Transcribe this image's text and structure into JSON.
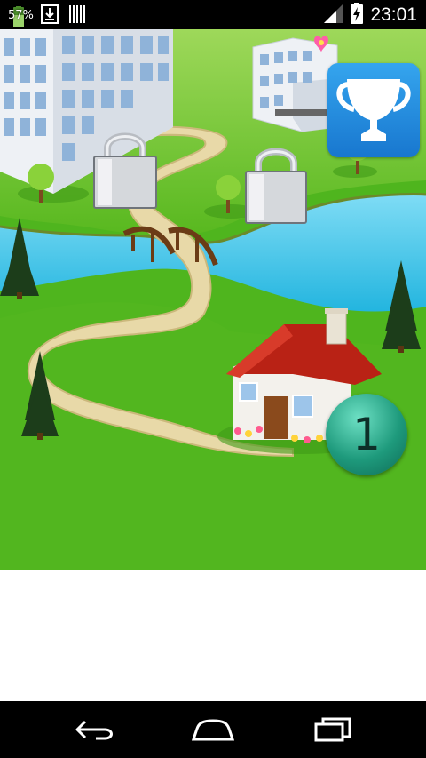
{
  "status_bar": {
    "battery_percent": "57%",
    "time": "23:01",
    "icons": [
      "battery-icon",
      "download-icon",
      "barcode-icon",
      "signal-icon",
      "battery-charging-icon"
    ]
  },
  "game": {
    "level_button": "1",
    "trophy_icon": "trophy-icon",
    "locked_levels": [
      "lock-icon",
      "lock-icon"
    ],
    "colors": {
      "grass": "#4fb51e",
      "water": "#36c3e6",
      "path": "#e8d9a8",
      "roof": "#b92215",
      "trophy_bg": "#1d86df"
    }
  },
  "nav_bar": {
    "icons": [
      "back-icon",
      "home-icon",
      "recents-icon"
    ]
  }
}
